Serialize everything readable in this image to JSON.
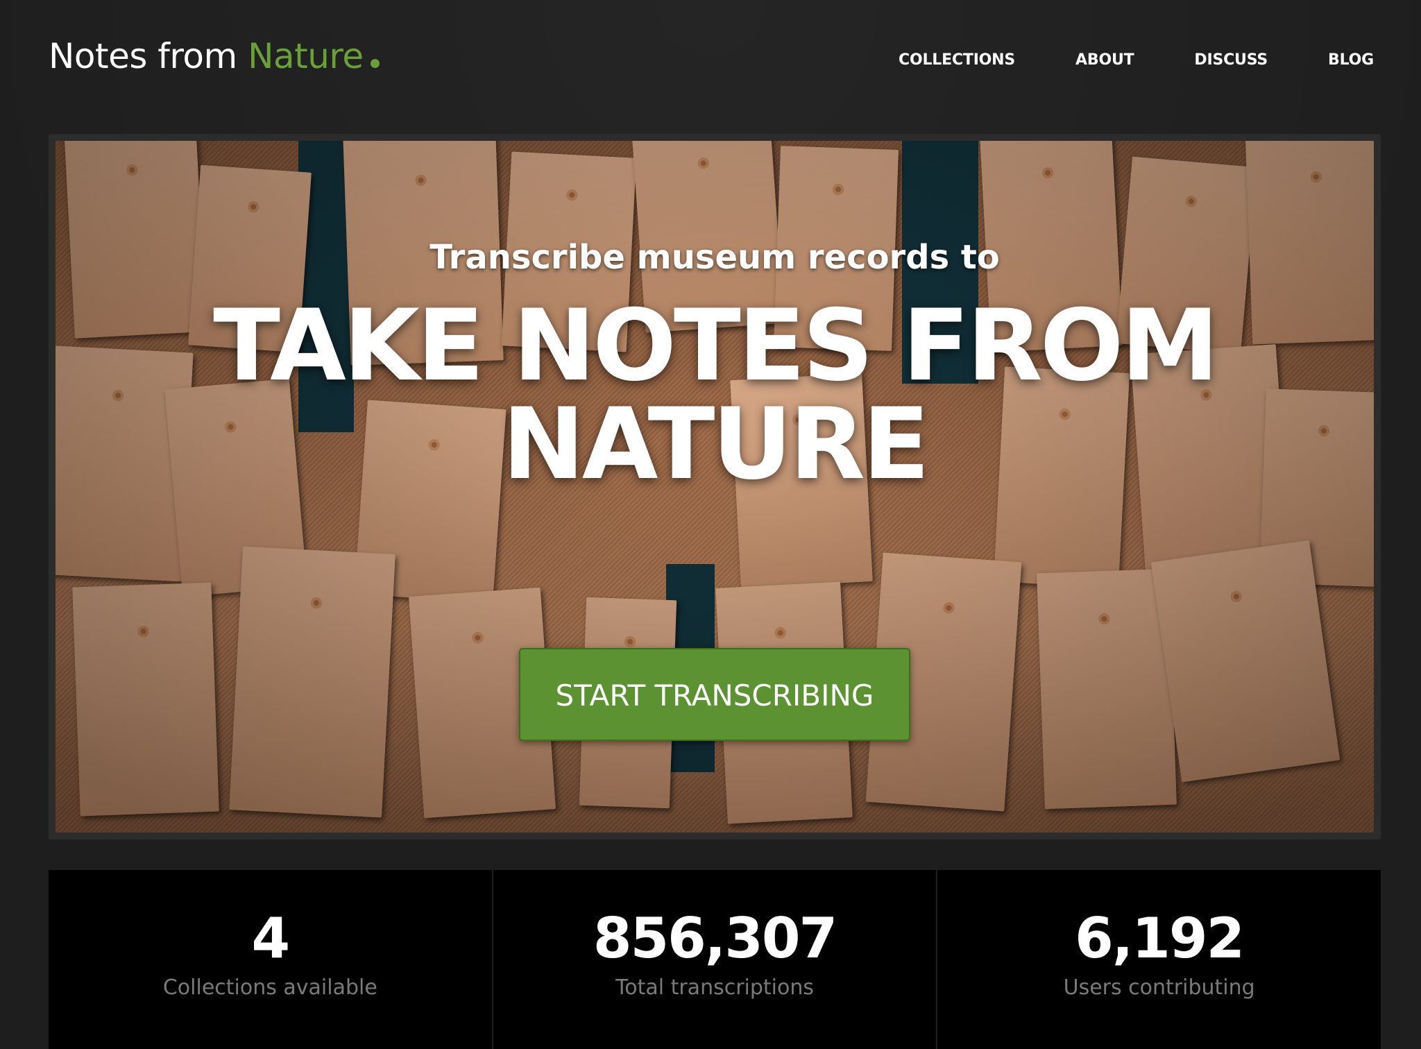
{
  "header": {
    "logo_part1": "Notes from",
    "logo_part2": "Nature",
    "nav": {
      "collections": "COLLECTIONS",
      "about": "ABOUT",
      "discuss": "DISCUSS",
      "blog": "BLOG"
    }
  },
  "hero": {
    "subtitle": "Transcribe museum records to",
    "title": "TAKE NOTES FROM NATURE",
    "cta_label": "START TRANSCRIBING"
  },
  "stats": {
    "collections": {
      "value": "4",
      "label": "Collections available"
    },
    "transcriptions": {
      "value": "856,307",
      "label": "Total transcriptions"
    },
    "users": {
      "value": "6,192",
      "label": "Users contributing"
    }
  },
  "colors": {
    "accent": "#6aa03a",
    "button": "#5d9232",
    "background": "#1e1e1e",
    "stat_background": "#000000",
    "stat_label": "#7a7a7a"
  },
  "icons": {
    "logo_dot": "green-dot-icon"
  }
}
